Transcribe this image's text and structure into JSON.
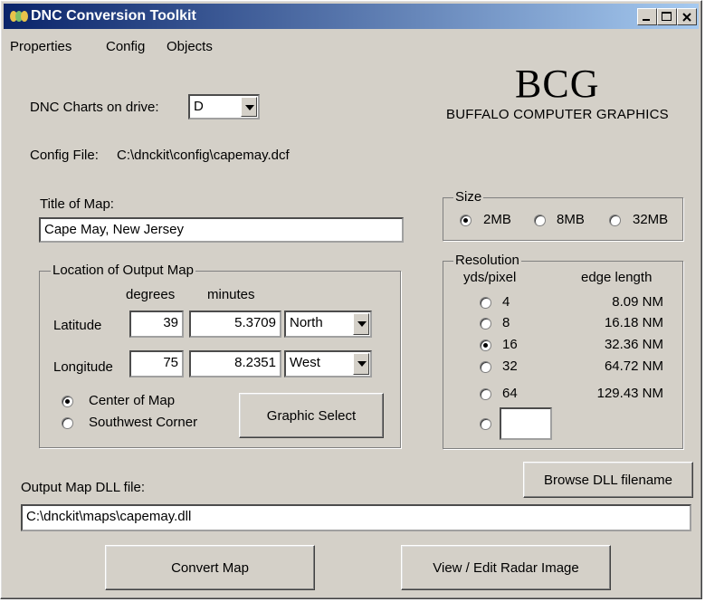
{
  "window": {
    "title": "DNC Conversion Toolkit",
    "titlebar_color": "#0a246a"
  },
  "menu": {
    "items": [
      "Properties",
      "Config",
      "Objects"
    ]
  },
  "logo": {
    "big": "BCG",
    "small": "BUFFALO COMPUTER GRAPHICS"
  },
  "drive": {
    "label": "DNC Charts on drive:",
    "value": "D"
  },
  "config": {
    "label": "Config File:",
    "path": "C:\\dnckit\\config\\capemay.dcf"
  },
  "title_of_map": {
    "label": "Title of Map:",
    "value": "Cape May, New Jersey"
  },
  "location": {
    "group_label": "Location of Output Map",
    "col_degrees": "degrees",
    "col_minutes": "minutes",
    "latitude": {
      "label": "Latitude",
      "degrees": "39",
      "minutes": "5.3709",
      "hemisphere": "North"
    },
    "longitude": {
      "label": "Longitude",
      "degrees": "75",
      "minutes": "8.2351",
      "hemisphere": "West"
    },
    "center_label": "Center of Map",
    "southwest_label": "Southwest Corner",
    "selected": "center",
    "graphic_select": "Graphic Select"
  },
  "size": {
    "group_label": "Size",
    "options": [
      "2MB",
      "8MB",
      "32MB"
    ],
    "selected_index": 0
  },
  "resolution": {
    "group_label": "Resolution",
    "col_yds": "yds/pixel",
    "col_edge": "edge length",
    "rows": [
      {
        "yds": "4",
        "edge": "8.09 NM"
      },
      {
        "yds": "8",
        "edge": "16.18 NM"
      },
      {
        "yds": "16",
        "edge": "32.36 NM"
      },
      {
        "yds": "32",
        "edge": "64.72 NM"
      },
      {
        "yds": "64",
        "edge": "129.43 NM"
      }
    ],
    "selected_index": 2,
    "custom_value": ""
  },
  "output": {
    "label": "Output Map DLL file:",
    "path": "C:\\dnckit\\maps\\capemay.dll",
    "browse": "Browse DLL filename"
  },
  "actions": {
    "convert": "Convert Map",
    "view_edit": "View / Edit Radar Image"
  }
}
